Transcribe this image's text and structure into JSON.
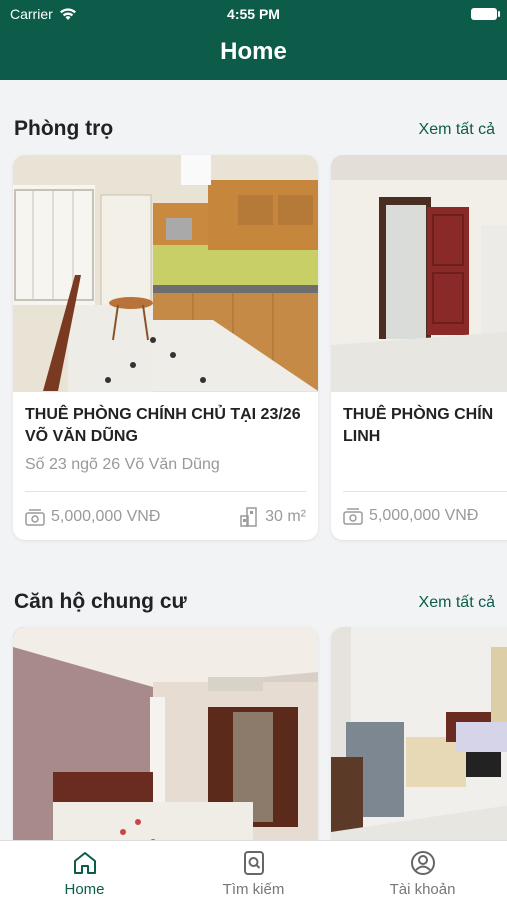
{
  "status_bar": {
    "carrier": "Carrier",
    "time": "4:55 PM"
  },
  "header": {
    "title": "Home"
  },
  "sections": [
    {
      "title": "Phòng trọ",
      "see_all": "Xem tất cả",
      "cards": [
        {
          "name": "THUÊ PHÒNG CHÍNH CHỦ TẠI 23/26 VÕ VĂN DŨNG",
          "address": "Số 23 ngõ 26 Võ Văn Dũng",
          "price": "5,000,000 VNĐ",
          "area": "30 m²"
        },
        {
          "name": "THUÊ PHÒNG CHÍN LINH",
          "address": "",
          "price": "5,000,000 VNĐ",
          "area": ""
        }
      ]
    },
    {
      "title": "Căn hộ chung cư",
      "see_all": "Xem tất cả",
      "cards": [
        {},
        {}
      ]
    }
  ],
  "tabs": [
    {
      "label": "Home",
      "icon": "home-icon",
      "active": true
    },
    {
      "label": "Tìm kiếm",
      "icon": "search-icon",
      "active": false
    },
    {
      "label": "Tài khoản",
      "icon": "account-icon",
      "active": false
    }
  ],
  "colors": {
    "primary": "#0d5c4a",
    "background": "#f2f3f5"
  }
}
